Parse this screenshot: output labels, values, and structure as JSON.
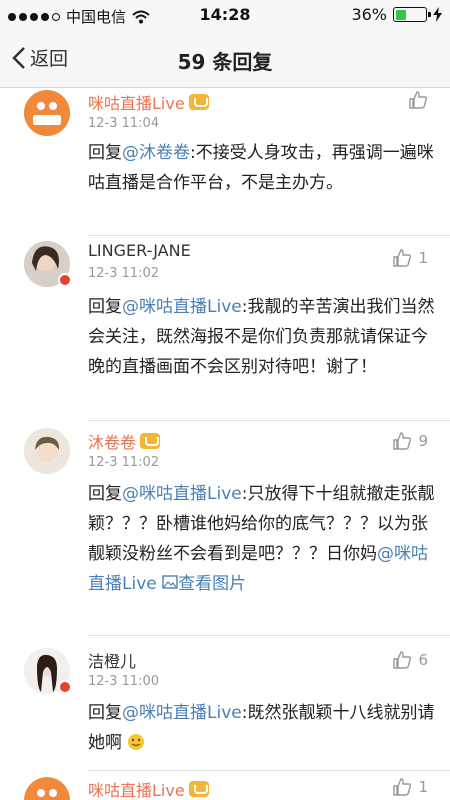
{
  "status": {
    "carrier": "中国电信",
    "time": "14:28",
    "battery": "36%"
  },
  "nav": {
    "back_label": "返回",
    "title": "59 条回复"
  },
  "comments": [
    {
      "name": "咪咕直播Live",
      "time": "12-3 11:04",
      "likes": "",
      "reply_prefix": "回复",
      "mention": "@沐卷卷",
      "text": ":不接受人身攻击，再强调一遍咪咕直播是合作平台，不是主办方。"
    },
    {
      "name": "LINGER-JANE",
      "time": "12-3 11:02",
      "likes": "1",
      "reply_prefix": "回复",
      "mention": "@咪咕直播Live",
      "text": ":我靓的辛苦演出我们当然会关注，既然海报不是你们负责那就请保证今晚的直播画面不会区别对待吧！谢了！"
    },
    {
      "name": "沐卷卷",
      "time": "12-3 11:02",
      "likes": "9",
      "reply_prefix": "回复",
      "mention": "@咪咕直播Live",
      "text": ":只放得下十组就撤走张靓颖？？？卧槽谁他妈给你的底气？？？以为张靓颖没粉丝不会看到是吧？？？日你妈",
      "mention2": "@咪咕直播Live",
      "link": "查看图片"
    },
    {
      "name": "洁橙儿",
      "time": "12-3 11:00",
      "likes": "6",
      "reply_prefix": "回复",
      "mention": "@咪咕直播Live",
      "text": ":既然张靓颖十八线就别请她啊"
    },
    {
      "name": "咪咕直播Live",
      "time": "",
      "likes": "1"
    }
  ]
}
